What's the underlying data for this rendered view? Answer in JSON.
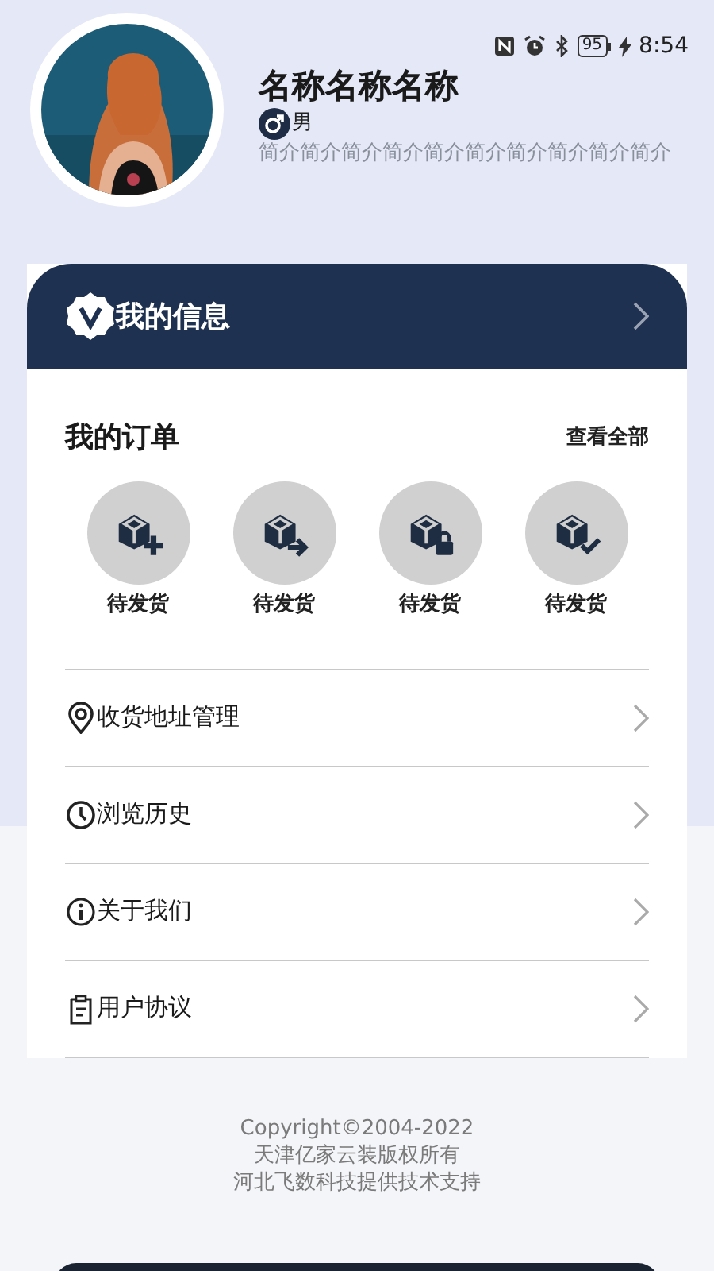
{
  "status_bar": {
    "battery": "95",
    "time": "8:54"
  },
  "profile": {
    "name": "名称名称名称",
    "gender": "男",
    "bio": "简介简介简介简介简介简介简介简介简介简介"
  },
  "info_card": {
    "title": "我的信息"
  },
  "orders": {
    "title": "我的订单",
    "view_all": "查看全部",
    "items": [
      {
        "kind": "add",
        "label": "待发货"
      },
      {
        "kind": "send",
        "label": "待发货"
      },
      {
        "kind": "lock",
        "label": "待发货"
      },
      {
        "kind": "done",
        "label": "待发货"
      }
    ]
  },
  "menu": [
    {
      "kind": "location",
      "label": "收货地址管理"
    },
    {
      "kind": "history",
      "label": "浏览历史"
    },
    {
      "kind": "about",
      "label": "关于我们"
    },
    {
      "kind": "agreement",
      "label": "用户协议"
    }
  ],
  "footer": [
    "Copyright©2004-2022",
    "天津亿家云装版权所有",
    "河北飞数科技提供技术支持"
  ]
}
